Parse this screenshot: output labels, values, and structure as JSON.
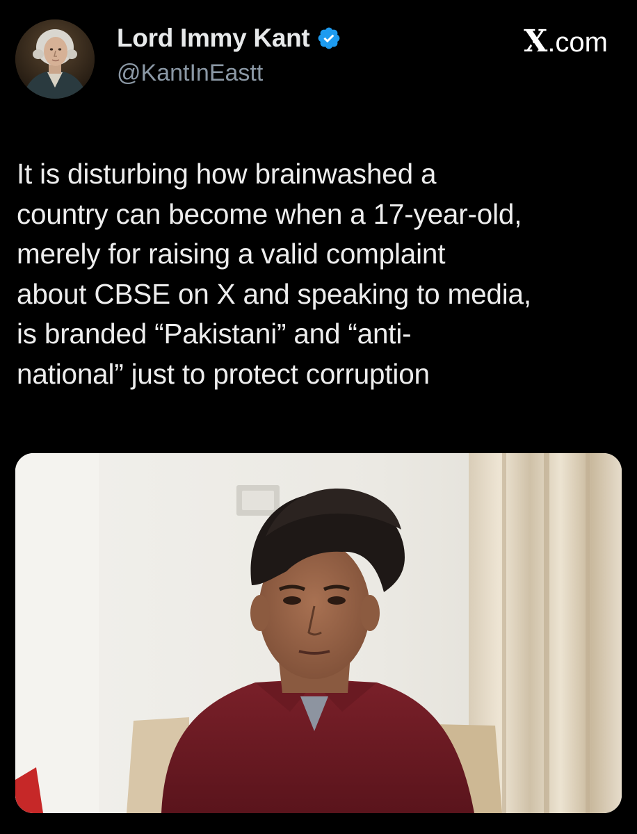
{
  "author": {
    "display_name": "Lord Immy Kant",
    "handle": "@KantInEastt",
    "verified": true,
    "avatar_icon": "portrait-avatar-icon",
    "verified_icon": "verified-badge-icon",
    "verified_color": "#1d9bf0"
  },
  "brand": {
    "x_glyph": "X",
    "suffix": ".com"
  },
  "tweet": {
    "text": "It is disturbing how brainwashed a\ncountry can become when a 17-year-old,\nmerely for raising a valid complaint\nabout CBSE on X and speaking to media,\nis branded “Pakistani” and “anti-\nnational” just to protect corruption"
  },
  "media": {
    "type": "photo",
    "icon": "photo-teen-boy-interview-icon"
  },
  "colors": {
    "background": "#000000",
    "text": "#e7e9ea",
    "secondary": "#8b98a5",
    "verified": "#1d9bf0"
  }
}
